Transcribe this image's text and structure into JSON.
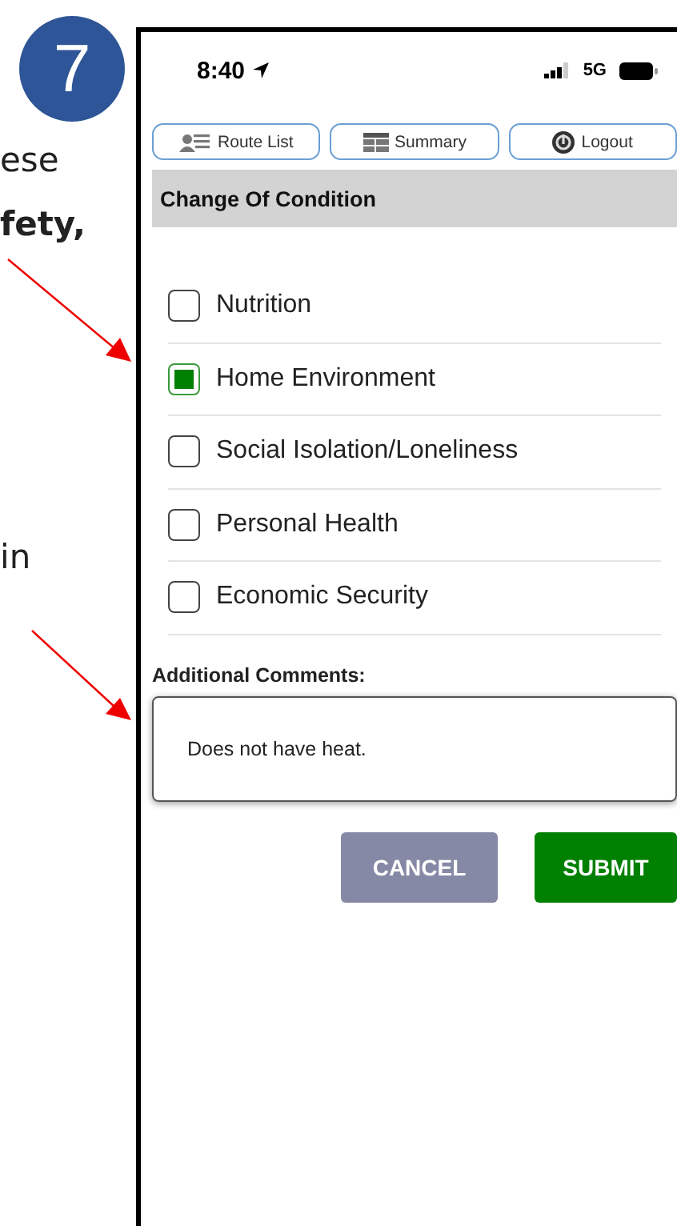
{
  "step_badge": "7",
  "instruction_fragments": [
    {
      "text": "ese",
      "kind": "plain"
    },
    {
      "text": "fety,",
      "kind": "bold"
    },
    {
      "text": "in",
      "kind": "plain"
    }
  ],
  "status_bar": {
    "time": "8:40",
    "network": "5G"
  },
  "nav_buttons": [
    {
      "label": "Route List",
      "kind": "route"
    },
    {
      "label": "Summary",
      "kind": "summary"
    },
    {
      "label": "Logout",
      "kind": "logout"
    }
  ],
  "section_title": "Change Of Condition",
  "conditions": [
    {
      "label": "Nutrition",
      "checked": false
    },
    {
      "label": "Home Environment",
      "checked": true
    },
    {
      "label": "Social Isolation/Loneliness",
      "checked": false
    },
    {
      "label": "Personal Health",
      "checked": false
    },
    {
      "label": "Economic Security",
      "checked": false
    }
  ],
  "comments": {
    "label": "Additional Comments:",
    "value": "Does not have heat."
  },
  "actions": [
    {
      "label": "CANCEL",
      "kind": "cancel"
    },
    {
      "label": "SUBMIT",
      "kind": "submit"
    }
  ]
}
